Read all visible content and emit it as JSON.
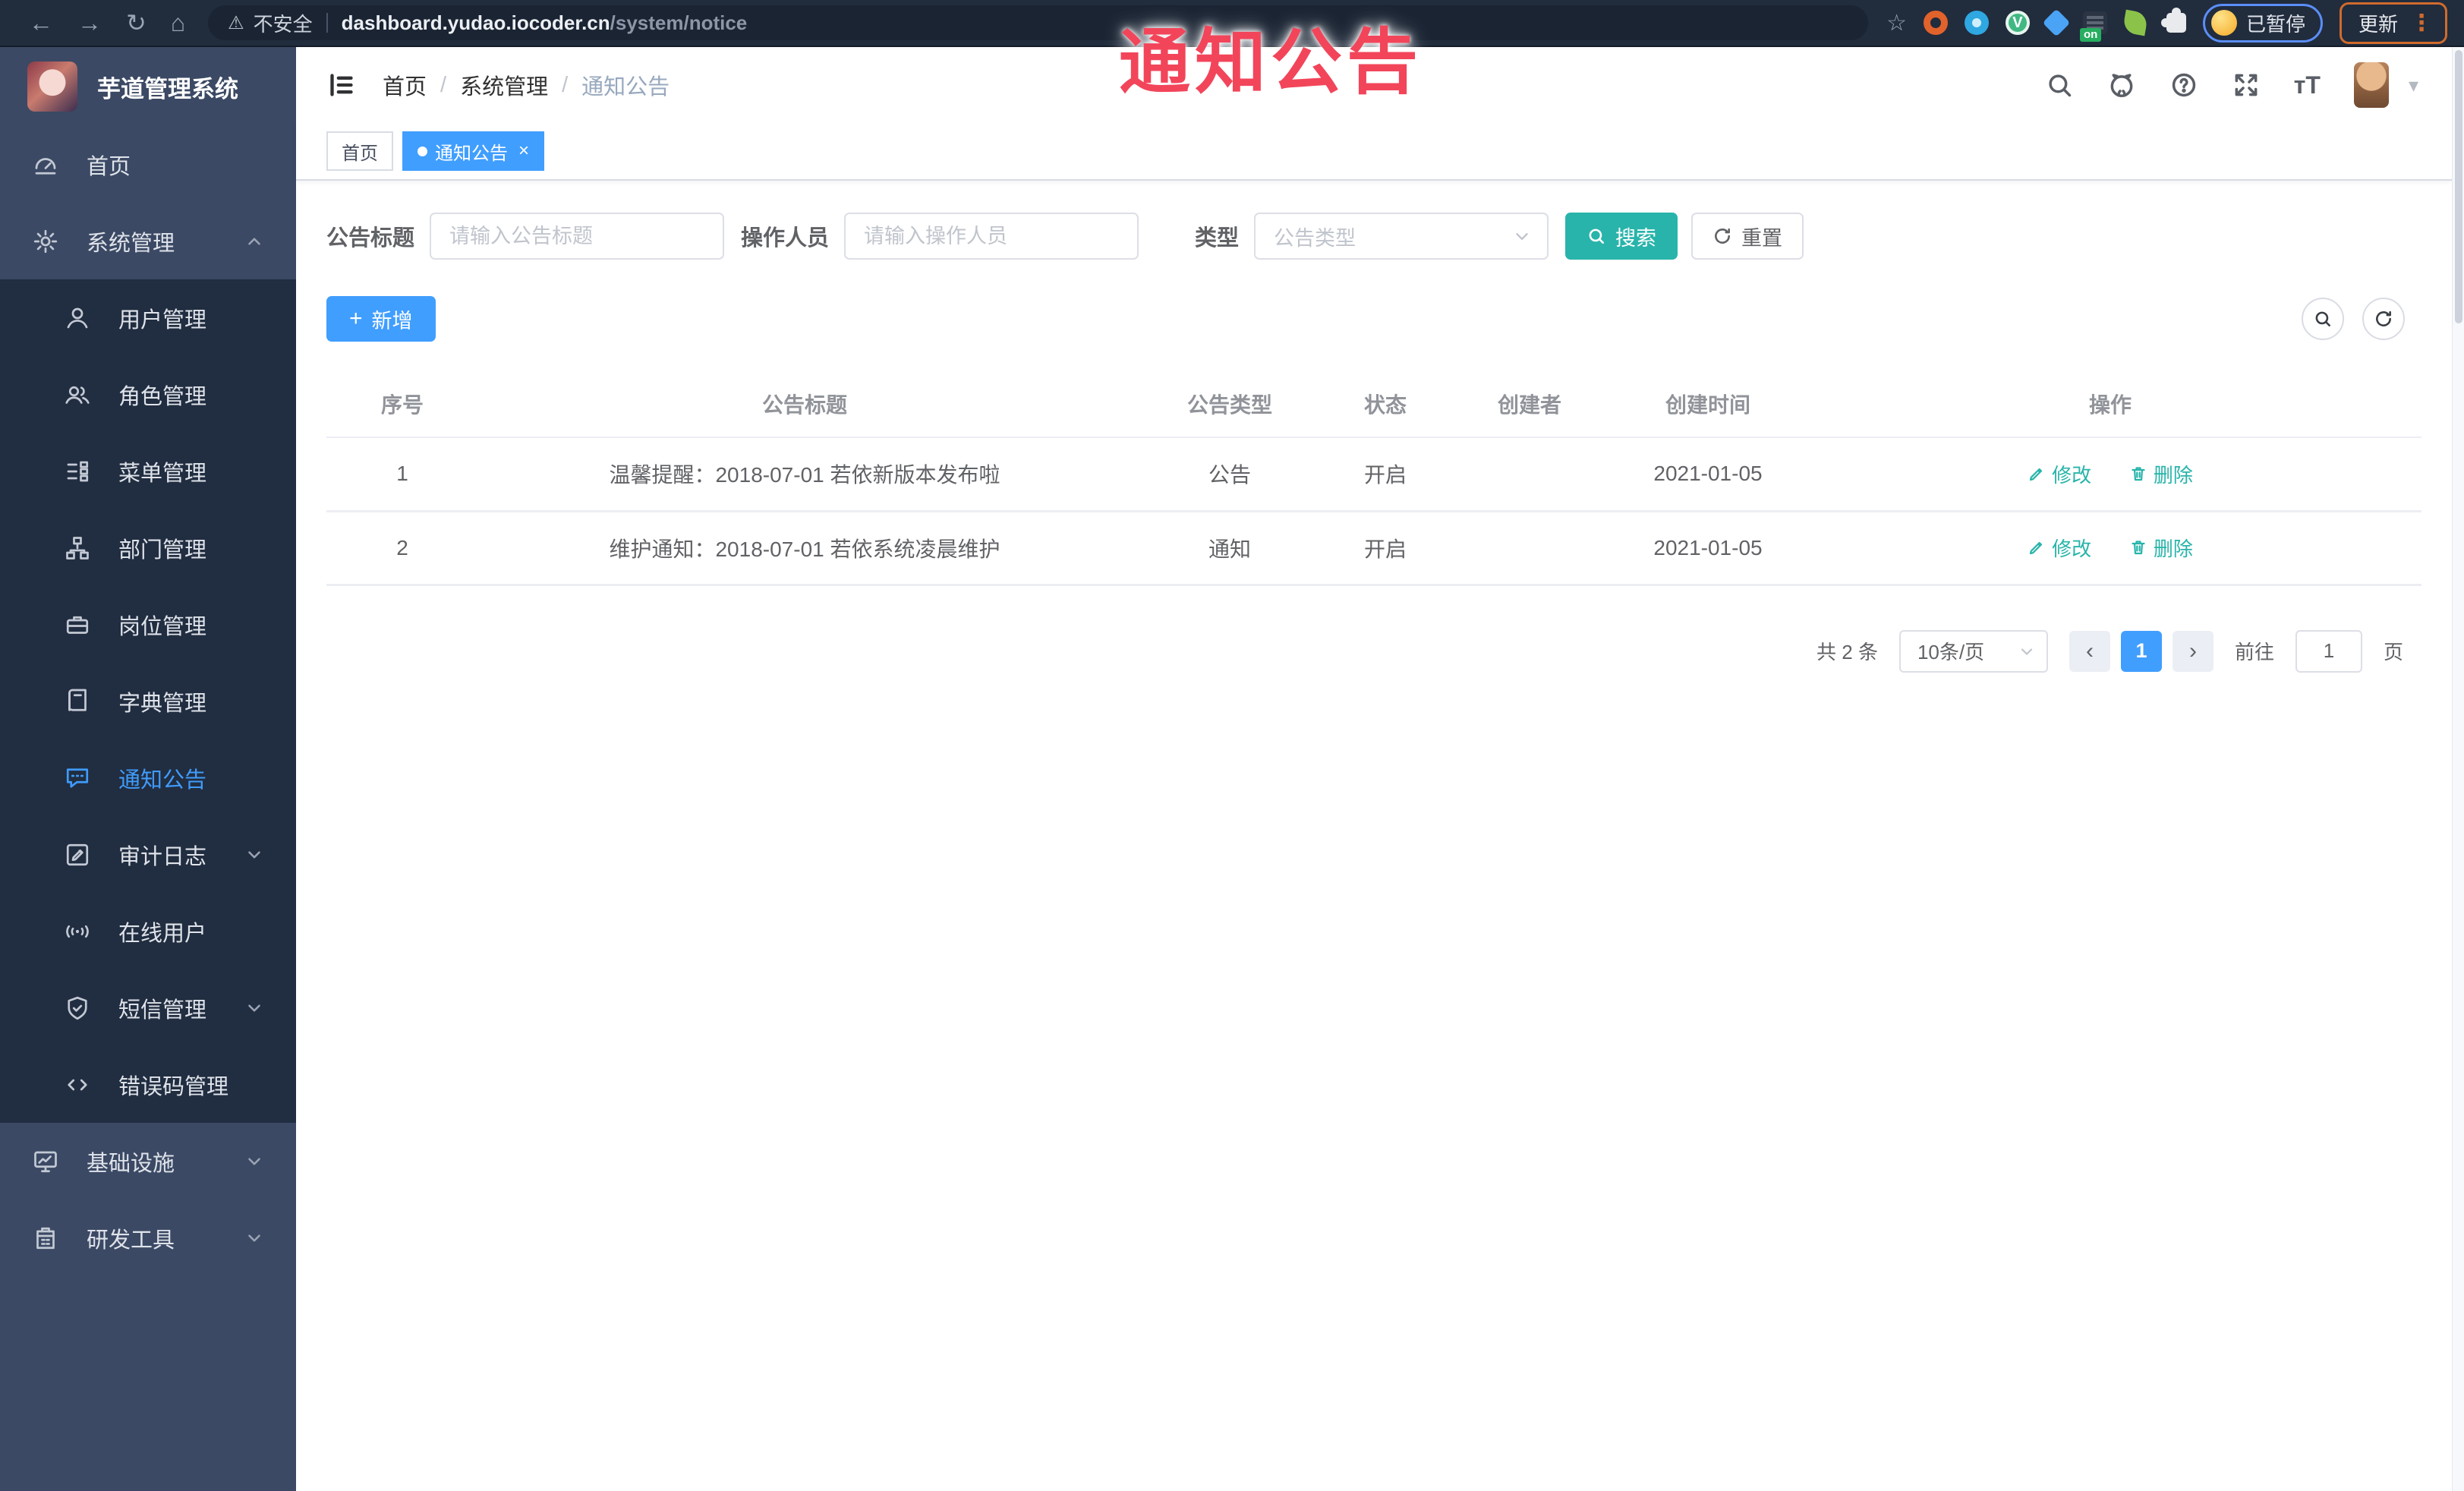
{
  "glyphs": {
    "back": "←",
    "forward": "→",
    "reload": "↻",
    "home": "⌂",
    "warning": "⚠",
    "star": "☆",
    "slash": "/",
    "caret": "▾",
    "close": "×",
    "plus": "+",
    "v": "V",
    "dots": "⋮",
    "font_size": "тT",
    "prev": "‹",
    "next": "›"
  },
  "browser": {
    "security_label": "不安全",
    "url_host": "dashboard.yudao.iocoder.cn",
    "url_path": "/system/notice",
    "ext_badge": "on",
    "paused_label": "已暂停",
    "update_label": "更新"
  },
  "overlay": {
    "title": "通知公告"
  },
  "sidebar": {
    "logo_title": "芋道管理系统",
    "items": [
      {
        "label": "首页"
      },
      {
        "label": "系统管理"
      },
      {
        "label": "用户管理"
      },
      {
        "label": "角色管理"
      },
      {
        "label": "菜单管理"
      },
      {
        "label": "部门管理"
      },
      {
        "label": "岗位管理"
      },
      {
        "label": "字典管理"
      },
      {
        "label": "通知公告"
      },
      {
        "label": "审计日志"
      },
      {
        "label": "在线用户"
      },
      {
        "label": "短信管理"
      },
      {
        "label": "错误码管理"
      },
      {
        "label": "基础设施"
      },
      {
        "label": "研发工具"
      }
    ]
  },
  "header": {
    "breadcrumb": {
      "home": "首页",
      "section": "系统管理",
      "current": "通知公告"
    }
  },
  "tags": {
    "home": "首页",
    "current": "通知公告"
  },
  "filters": {
    "title_label": "公告标题",
    "title_placeholder": "请输入公告标题",
    "operator_label": "操作人员",
    "operator_placeholder": "请输入操作人员",
    "type_label": "类型",
    "type_placeholder": "公告类型",
    "search_label": "搜索",
    "reset_label": "重置"
  },
  "toolbar": {
    "add_label": "新增"
  },
  "table": {
    "columns": [
      "序号",
      "公告标题",
      "公告类型",
      "状态",
      "创建者",
      "创建时间",
      "操作"
    ],
    "rows": [
      {
        "no": "1",
        "title": "温馨提醒：2018-07-01 若依新版本发布啦",
        "type": "公告",
        "status": "开启",
        "creator": "",
        "created": "2021-01-05"
      },
      {
        "no": "2",
        "title": "维护通知：2018-07-01 若依系统凌晨维护",
        "type": "通知",
        "status": "开启",
        "creator": "",
        "created": "2021-01-05"
      }
    ],
    "edit_label": "修改",
    "delete_label": "删除"
  },
  "pagination": {
    "total": "共 2 条",
    "page_size": "10条/页",
    "page": "1",
    "goto": "前往",
    "goto_value": "1",
    "unit": "页"
  },
  "colors": {
    "primary_blue": "#409eff",
    "theme_teal": "#28b4aa",
    "overlay_red": "#f2455a",
    "sidebar_bg": "#3b4964",
    "submenu_bg": "#212d40",
    "chrome_bg": "#212c3d"
  }
}
